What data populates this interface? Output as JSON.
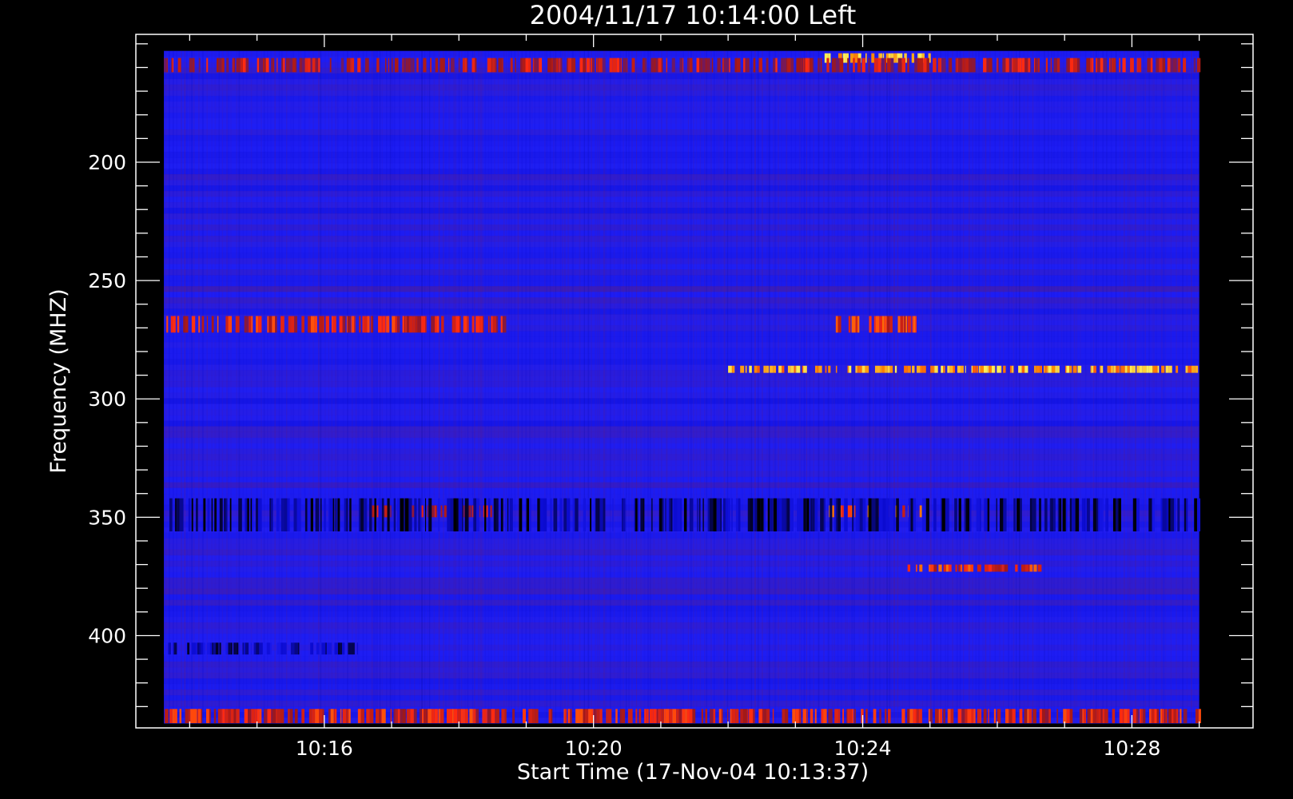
{
  "chart_data": {
    "type": "heatmap",
    "title": "2004/11/17 10:14:00 Left",
    "xlabel": "Start Time (17-Nov-04 10:13:37)",
    "ylabel": "Frequency (MHZ)",
    "x_axis": {
      "unit": "time (HH:MM, 17-Nov-2004)",
      "range": [
        "10:13:12",
        "10:29:48"
      ],
      "data_range": [
        "10:13:37",
        "10:29:00"
      ],
      "major_ticks": [
        "10:16",
        "10:20",
        "10:24",
        "10:28"
      ],
      "minor_tick_interval_min": 1
    },
    "y_axis": {
      "unit": "MHz",
      "inverted": true,
      "range": [
        146,
        439
      ],
      "data_range": [
        153,
        437
      ],
      "major_ticks": [
        200,
        250,
        300,
        350,
        400
      ],
      "minor_tick_interval": 10
    },
    "colormap": {
      "name": "blue-red-yellow",
      "stops": [
        "#000000",
        "#0b0bd0",
        "#1e1ef5",
        "#4a1a9a",
        "#a01818",
        "#ff2a10",
        "#ff8a00",
        "#ffee55"
      ]
    },
    "features": [
      {
        "description": "bright yellow/red band",
        "freq_mhz": [
          154,
          158
        ],
        "time": [
          "10:23:26",
          "10:25:00"
        ],
        "intensity": 0.95
      },
      {
        "description": "red/orange band",
        "freq_mhz": [
          156,
          162
        ],
        "time": [
          "10:13:37",
          "10:29:00"
        ],
        "intensity": 0.6
      },
      {
        "description": "red band",
        "freq_mhz": [
          265,
          272
        ],
        "time": [
          "10:13:37",
          "10:18:40"
        ],
        "intensity": 0.65
      },
      {
        "description": "red band",
        "freq_mhz": [
          265,
          272
        ],
        "time": [
          "10:23:30",
          "10:24:48"
        ],
        "intensity": 0.7
      },
      {
        "description": "yellow/orange narrow line",
        "freq_mhz": [
          286,
          289
        ],
        "time": [
          "10:22:00",
          "10:29:00"
        ],
        "intensity": 0.9
      },
      {
        "description": "red band",
        "freq_mhz": [
          345,
          350
        ],
        "time": [
          "10:23:30",
          "10:24:55"
        ],
        "intensity": 0.75
      },
      {
        "description": "red band",
        "freq_mhz": [
          345,
          350
        ],
        "time": [
          "10:16:40",
          "10:18:35"
        ],
        "intensity": 0.6
      },
      {
        "description": "red dashed line",
        "freq_mhz": [
          370,
          373
        ],
        "time": [
          "10:24:40",
          "10:26:40"
        ],
        "intensity": 0.7
      },
      {
        "description": "red/orange band near bottom",
        "freq_mhz": [
          431,
          437
        ],
        "time": [
          "10:13:37",
          "10:29:00"
        ],
        "intensity": 0.65
      },
      {
        "description": "dark absorption band",
        "freq_mhz": [
          342,
          356
        ],
        "time": [
          "10:13:37",
          "10:29:00"
        ],
        "intensity": 0.1
      },
      {
        "description": "dark absorption band",
        "freq_mhz": [
          403,
          408
        ],
        "time": [
          "10:13:37",
          "10:16:30"
        ],
        "intensity": 0.15
      }
    ]
  }
}
